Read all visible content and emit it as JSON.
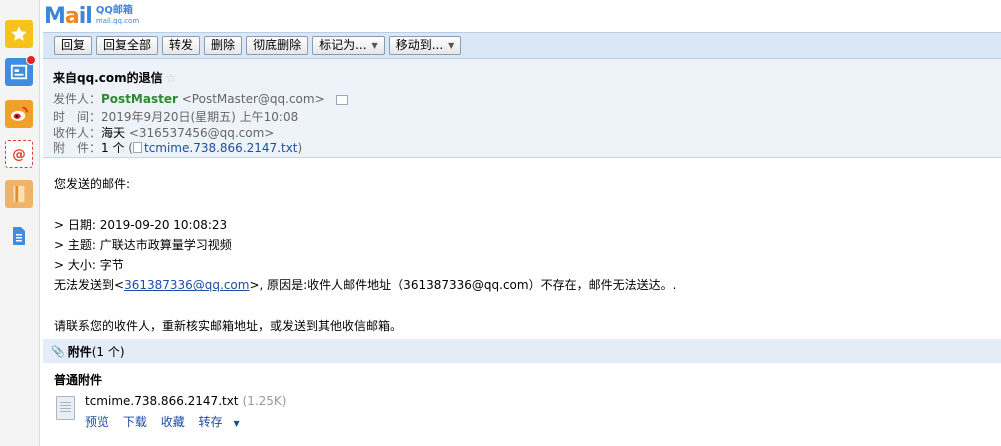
{
  "logo": {
    "word_pre": "M",
    "word_o": "a",
    "word_post": "il",
    "sub_cn": "QQ邮箱",
    "sub_url": "mail.qq.com"
  },
  "toolbar": {
    "reply": "回复",
    "reply_all": "回复全部",
    "forward": "转发",
    "delete": "删除",
    "delete_permanent": "彻底删除",
    "mark_as": "标记为...",
    "move_to": "移动到..."
  },
  "header": {
    "subject": "来自qq.com的退信",
    "from_label": "发件人：",
    "from_name": "PostMaster",
    "from_email": "<PostMaster@qq.com>",
    "time_label": "时　间：",
    "time_value": "2019年9月20日(星期五) 上午10:08",
    "to_label": "收件人：",
    "to_name": "海天",
    "to_email": "<316537456@qq.com>",
    "attach_label": "附　件：",
    "attach_count": "1 个",
    "attach_paren_open": "(",
    "attach_file": "tcmime.738.866.2147.txt",
    "attach_paren_close": ")"
  },
  "body": {
    "line1": "您发送的邮件:",
    "date_line": "> 日期: 2019-09-20 10:08:23",
    "subject_line": "> 主题: 广联达市政算量学习视频",
    "size_line": "> 大小: 字节",
    "fail_pre": "无法发送到<",
    "fail_link": "361387336@qq.com",
    "fail_post": ">, 原因是:收件人邮件地址（361387336@qq.com）不存在，邮件无法送达。.",
    "advice": "请联系您的收件人，重新核实邮箱地址，或发送到其他收信邮箱。"
  },
  "attachments": {
    "title": "附件",
    "count": "(1 个)",
    "section": "普通附件",
    "file_name": "tcmime.738.866.2147.txt",
    "file_size": "(1.25K)",
    "actions": {
      "preview": "预览",
      "download": "下载",
      "favorite": "收藏",
      "save_to": "转存"
    }
  },
  "colors": {
    "toolbar_bg": "#d9e7f7",
    "header_bg": "#eef3f9",
    "link": "#1c4ea6",
    "sender": "#2d8a2d"
  }
}
